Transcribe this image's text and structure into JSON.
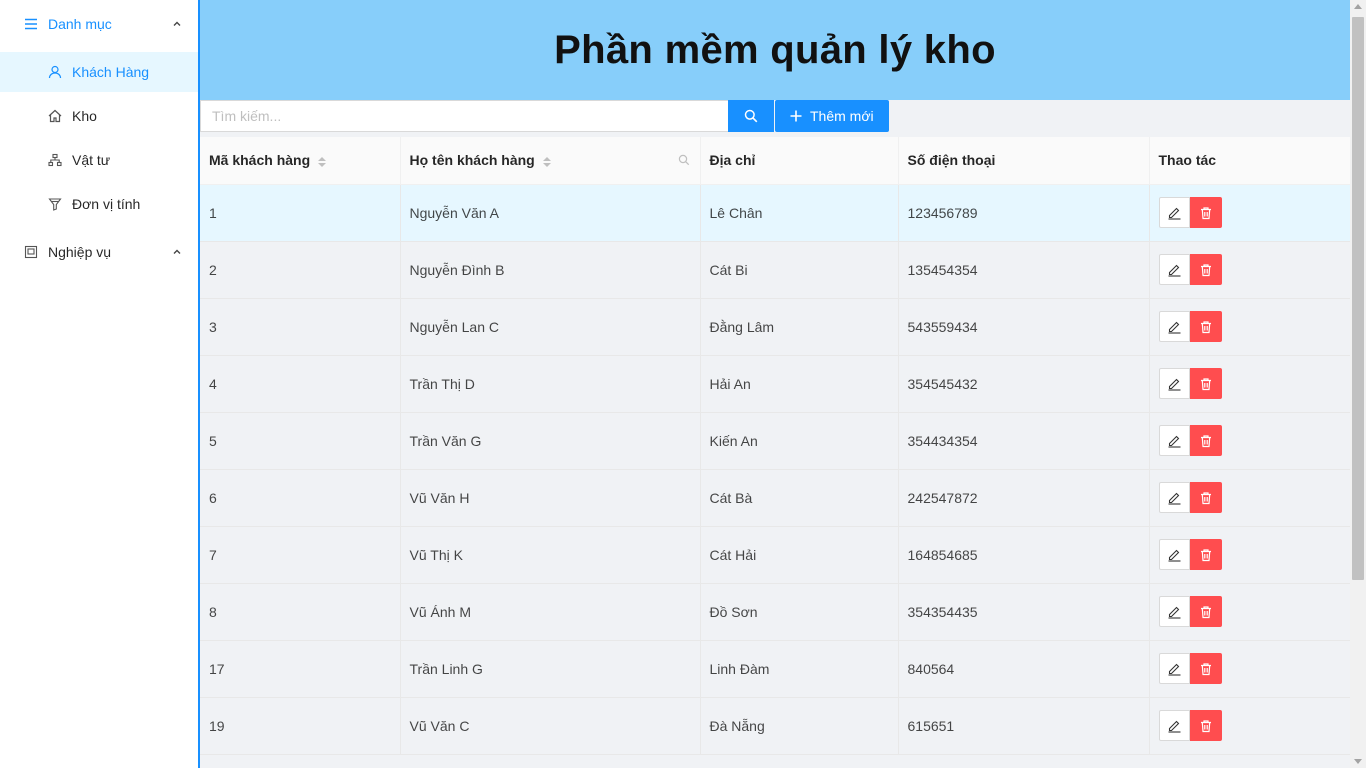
{
  "sidebar": {
    "group1": {
      "label": "Danh mục",
      "icon": "menu-icon"
    },
    "items": [
      {
        "label": "Khách Hàng",
        "icon": "user-icon"
      },
      {
        "label": "Kho",
        "icon": "home-icon"
      },
      {
        "label": "Vật tư",
        "icon": "apartment-icon"
      },
      {
        "label": "Đơn vị tính",
        "icon": "filter-icon"
      }
    ],
    "group2": {
      "label": "Nghiệp vụ",
      "icon": "container-icon"
    }
  },
  "header": {
    "title": "Phần mềm quản lý kho"
  },
  "toolbar": {
    "search_placeholder": "Tìm kiếm...",
    "add_label": "Thêm mới"
  },
  "table": {
    "columns": [
      "Mã khách hàng",
      "Họ tên khách hàng",
      "Địa chỉ",
      "Số điện thoại",
      "Thao tác"
    ],
    "rows": [
      {
        "id": "1",
        "name": "Nguyễn Văn A",
        "address": "Lê Chân",
        "phone": "123456789"
      },
      {
        "id": "2",
        "name": "Nguyễn Đình B",
        "address": "Cát Bi",
        "phone": "135454354"
      },
      {
        "id": "3",
        "name": "Nguyễn Lan C",
        "address": "Đằng Lâm",
        "phone": "543559434"
      },
      {
        "id": "4",
        "name": "Trần Thị D",
        "address": "Hải An",
        "phone": "354545432"
      },
      {
        "id": "5",
        "name": "Trần Văn G",
        "address": "Kiến An",
        "phone": "354434354"
      },
      {
        "id": "6",
        "name": "Vũ Văn H",
        "address": "Cát Bà",
        "phone": "242547872"
      },
      {
        "id": "7",
        "name": "Vũ Thị K",
        "address": "Cát Hải",
        "phone": "164854685"
      },
      {
        "id": "8",
        "name": "Vũ Ánh M",
        "address": "Đồ Sơn",
        "phone": "354354435"
      },
      {
        "id": "17",
        "name": "Trần Linh G",
        "address": "Linh Đàm",
        "phone": "840564"
      },
      {
        "id": "19",
        "name": "Vũ Văn C",
        "address": "Đà Nẵng",
        "phone": "615651"
      }
    ]
  },
  "colors": {
    "primary": "#1890ff",
    "header_bg": "#87cefa",
    "danger": "#ff4d4f",
    "selected_bg": "#e6f7ff"
  }
}
